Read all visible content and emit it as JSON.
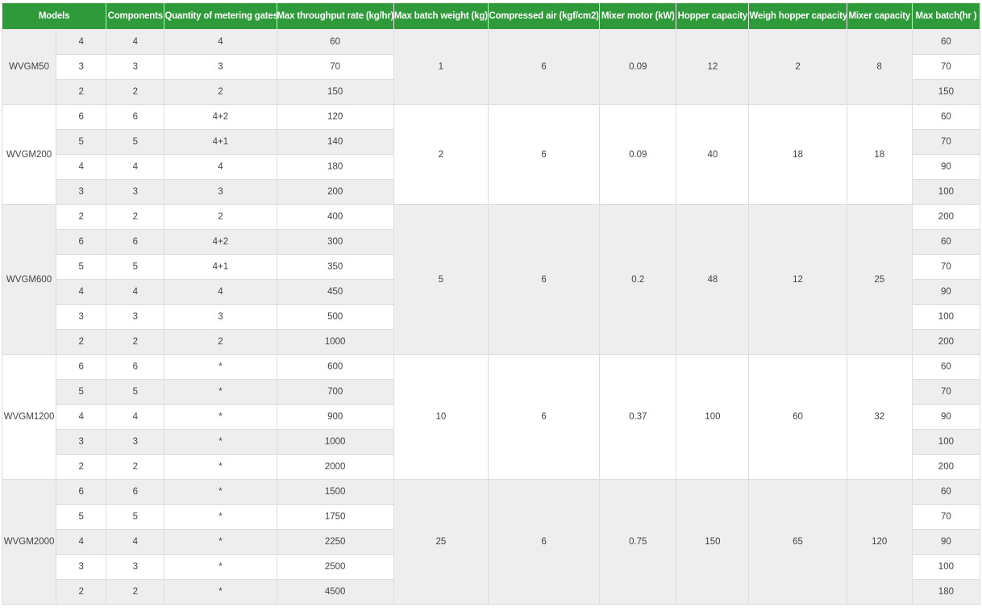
{
  "headers": [
    "Models",
    "Components",
    "Quantity of metering gates",
    "Max throughput rate (kg/hr)",
    "Max batch weight (kg)",
    "Compressed air (kgf/cm2)",
    "Mixer motor (kW)",
    "Hopper capacity",
    "Weigh hopper capacity",
    "Mixer capacity",
    "Max batch(hr )"
  ],
  "groups": [
    {
      "model": "WVGM50",
      "max_batch_weight": "1",
      "compressed_air": "6",
      "mixer_motor": "0.09",
      "hopper_capacity": "12",
      "weigh_hopper_capacity": "2",
      "mixer_capacity": "8",
      "rows": [
        {
          "no": "4",
          "components": "4",
          "gates": "4",
          "throughput": "60",
          "batch_hr": "60"
        },
        {
          "no": "3",
          "components": "3",
          "gates": "3",
          "throughput": "70",
          "batch_hr": "70"
        },
        {
          "no": "2",
          "components": "2",
          "gates": "2",
          "throughput": "150",
          "batch_hr": "150"
        }
      ]
    },
    {
      "model": "WVGM200",
      "max_batch_weight": "2",
      "compressed_air": "6",
      "mixer_motor": "0.09",
      "hopper_capacity": "40",
      "weigh_hopper_capacity": "18",
      "mixer_capacity": "18",
      "rows": [
        {
          "no": "6",
          "components": "6",
          "gates": "4+2",
          "throughput": "120",
          "batch_hr": "60"
        },
        {
          "no": "5",
          "components": "5",
          "gates": "4+1",
          "throughput": "140",
          "batch_hr": "70"
        },
        {
          "no": "4",
          "components": "4",
          "gates": "4",
          "throughput": "180",
          "batch_hr": "90"
        },
        {
          "no": "3",
          "components": "3",
          "gates": "3",
          "throughput": "200",
          "batch_hr": "100"
        }
      ]
    },
    {
      "model": "WVGM600",
      "max_batch_weight": "5",
      "compressed_air": "6",
      "mixer_motor": "0.2",
      "hopper_capacity": "48",
      "weigh_hopper_capacity": "12",
      "mixer_capacity": "25",
      "rows": [
        {
          "no": "2",
          "components": "2",
          "gates": "2",
          "throughput": "400",
          "batch_hr": "200"
        },
        {
          "no": "6",
          "components": "6",
          "gates": "4+2",
          "throughput": "300",
          "batch_hr": "60"
        },
        {
          "no": "5",
          "components": "5",
          "gates": "4+1",
          "throughput": "350",
          "batch_hr": "70"
        },
        {
          "no": "4",
          "components": "4",
          "gates": "4",
          "throughput": "450",
          "batch_hr": "90"
        },
        {
          "no": "3",
          "components": "3",
          "gates": "3",
          "throughput": "500",
          "batch_hr": "100"
        },
        {
          "no": "2",
          "components": "2",
          "gates": "2",
          "throughput": "1000",
          "batch_hr": "200"
        }
      ]
    },
    {
      "model": "WVGM1200",
      "max_batch_weight": "10",
      "compressed_air": "6",
      "mixer_motor": "0.37",
      "hopper_capacity": "100",
      "weigh_hopper_capacity": "60",
      "mixer_capacity": "32",
      "rows": [
        {
          "no": "6",
          "components": "6",
          "gates": "*",
          "throughput": "600",
          "batch_hr": "60"
        },
        {
          "no": "5",
          "components": "5",
          "gates": "*",
          "throughput": "700",
          "batch_hr": "70"
        },
        {
          "no": "4",
          "components": "4",
          "gates": "*",
          "throughput": "900",
          "batch_hr": "90"
        },
        {
          "no": "3",
          "components": "3",
          "gates": "*",
          "throughput": "1000",
          "batch_hr": "100"
        },
        {
          "no": "2",
          "components": "2",
          "gates": "*",
          "throughput": "2000",
          "batch_hr": "200"
        }
      ]
    },
    {
      "model": "WVGM2000",
      "max_batch_weight": "25",
      "compressed_air": "6",
      "mixer_motor": "0.75",
      "hopper_capacity": "150",
      "weigh_hopper_capacity": "65",
      "mixer_capacity": "120",
      "rows": [
        {
          "no": "6",
          "components": "6",
          "gates": "*",
          "throughput": "1500",
          "batch_hr": "60"
        },
        {
          "no": "5",
          "components": "5",
          "gates": "*",
          "throughput": "1750",
          "batch_hr": "70"
        },
        {
          "no": "4",
          "components": "4",
          "gates": "*",
          "throughput": "2250",
          "batch_hr": "90"
        },
        {
          "no": "3",
          "components": "3",
          "gates": "*",
          "throughput": "2500",
          "batch_hr": "100"
        },
        {
          "no": "2",
          "components": "2",
          "gates": "*",
          "throughput": "4500",
          "batch_hr": "180"
        }
      ]
    }
  ]
}
